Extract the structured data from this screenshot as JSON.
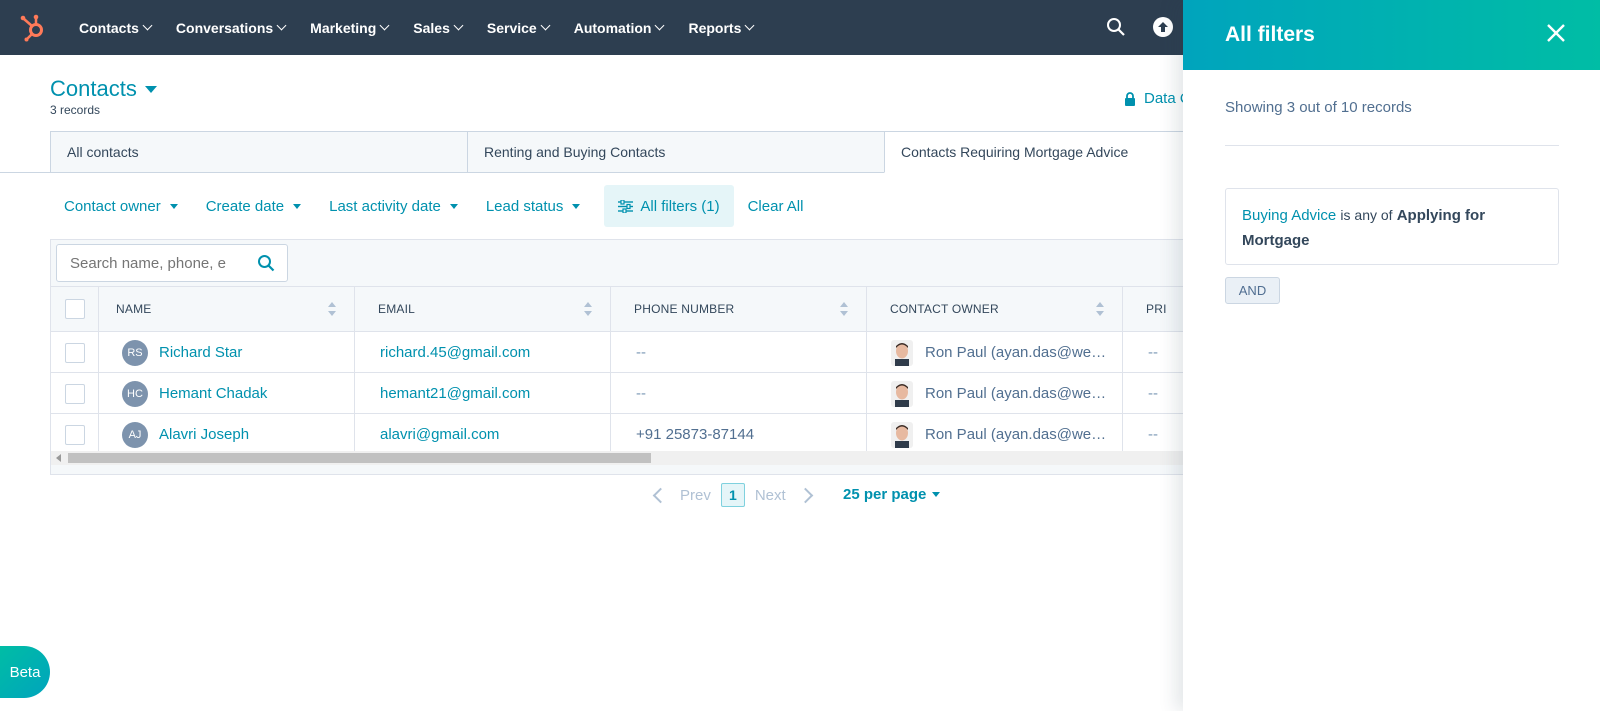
{
  "nav": {
    "items": [
      "Contacts",
      "Conversations",
      "Marketing",
      "Sales",
      "Service",
      "Automation",
      "Reports"
    ]
  },
  "header": {
    "title": "Contacts",
    "record_count": "3 records",
    "data_quality": "Data Q"
  },
  "tabs": [
    {
      "label": "All contacts"
    },
    {
      "label": "Renting and Buying Contacts"
    },
    {
      "label": "Contacts Requiring Mortgage Advice"
    }
  ],
  "filters": {
    "items": [
      "Contact owner",
      "Create date",
      "Last activity date",
      "Lead status"
    ],
    "all_filters": "All filters (1)",
    "clear_all": "Clear All"
  },
  "search": {
    "placeholder": "Search name, phone, e"
  },
  "table": {
    "columns": [
      "NAME",
      "EMAIL",
      "PHONE NUMBER",
      "CONTACT OWNER",
      "PRI"
    ],
    "rows": [
      {
        "initials": "RS",
        "name": "Richard Star",
        "email": "richard.45@gmail.com",
        "phone": "--",
        "owner": "Ron Paul (ayan.das@we…",
        "extra": "--"
      },
      {
        "initials": "HC",
        "name": "Hemant Chadak",
        "email": "hemant21@gmail.com",
        "phone": "--",
        "owner": "Ron Paul (ayan.das@we…",
        "extra": "--"
      },
      {
        "initials": "AJ",
        "name": "Alavri Joseph",
        "email": "alavri@gmail.com",
        "phone": "+91 25873-87144",
        "owner": "Ron Paul (ayan.das@we…",
        "extra": "--"
      }
    ]
  },
  "pagination": {
    "prev": "Prev",
    "page": "1",
    "next": "Next",
    "per_page": "25 per page"
  },
  "beta": "Beta",
  "panel": {
    "title": "All filters",
    "showing": "Showing 3 out of 10 records",
    "filter": {
      "property": "Buying Advice",
      "operator": "is any of",
      "value": "Applying for Mortgage"
    },
    "and_label": "AND"
  },
  "colors": {
    "nav_bg": "#2d3e50",
    "accent": "#0091ae",
    "panel_gradient_start": "#00a4bd",
    "panel_gradient_end": "#00bda5",
    "logo": "#ff7a59"
  }
}
